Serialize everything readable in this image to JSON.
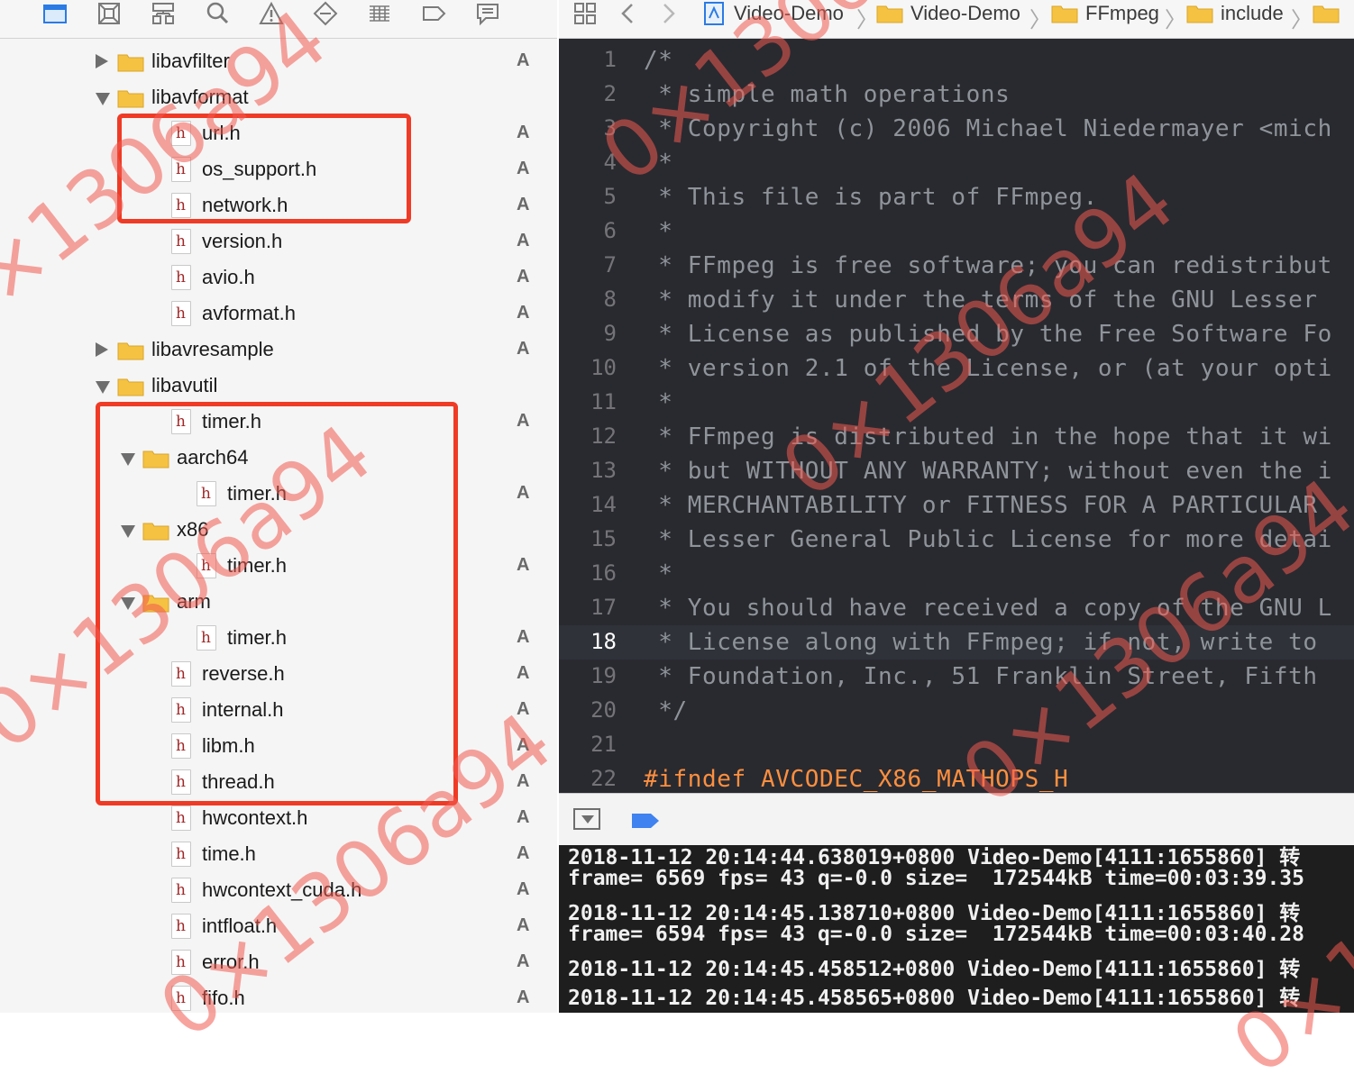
{
  "navigator": {
    "toolbar_icons": [
      "folder-icon",
      "source-control-icon",
      "hierarchy-icon",
      "search-icon",
      "warning-icon",
      "test-icon",
      "debug-icon",
      "breakpoint-icon",
      "report-icon"
    ],
    "tree": [
      {
        "name": "libavfilter",
        "kind": "folder",
        "state": "closed",
        "depth": 0,
        "status": "A"
      },
      {
        "name": "libavformat",
        "kind": "folder",
        "state": "open",
        "depth": 0,
        "status": ""
      },
      {
        "name": "url.h",
        "kind": "h",
        "depth": 1,
        "status": "A"
      },
      {
        "name": "os_support.h",
        "kind": "h",
        "depth": 1,
        "status": "A"
      },
      {
        "name": "network.h",
        "kind": "h",
        "depth": 1,
        "status": "A"
      },
      {
        "name": "version.h",
        "kind": "h",
        "depth": 1,
        "status": "A"
      },
      {
        "name": "avio.h",
        "kind": "h",
        "depth": 1,
        "status": "A"
      },
      {
        "name": "avformat.h",
        "kind": "h",
        "depth": 1,
        "status": "A"
      },
      {
        "name": "libavresample",
        "kind": "folder",
        "state": "closed",
        "depth": 0,
        "status": "A"
      },
      {
        "name": "libavutil",
        "kind": "folder",
        "state": "open",
        "depth": 0,
        "status": ""
      },
      {
        "name": "timer.h",
        "kind": "h",
        "depth": 1,
        "status": "A"
      },
      {
        "name": "aarch64",
        "kind": "folder",
        "state": "open",
        "depth": 1,
        "status": ""
      },
      {
        "name": "timer.h",
        "kind": "h",
        "depth": 2,
        "status": "A"
      },
      {
        "name": "x86",
        "kind": "folder",
        "state": "open",
        "depth": 1,
        "status": ""
      },
      {
        "name": "timer.h",
        "kind": "h",
        "depth": 2,
        "status": "A"
      },
      {
        "name": "arm",
        "kind": "folder",
        "state": "open",
        "depth": 1,
        "status": ""
      },
      {
        "name": "timer.h",
        "kind": "h",
        "depth": 2,
        "status": "A"
      },
      {
        "name": "reverse.h",
        "kind": "h",
        "depth": 1,
        "status": "A"
      },
      {
        "name": "internal.h",
        "kind": "h",
        "depth": 1,
        "status": "A"
      },
      {
        "name": "libm.h",
        "kind": "h",
        "depth": 1,
        "status": "A"
      },
      {
        "name": "thread.h",
        "kind": "h",
        "depth": 1,
        "status": "A"
      },
      {
        "name": "hwcontext.h",
        "kind": "h",
        "depth": 1,
        "status": "A"
      },
      {
        "name": "time.h",
        "kind": "h",
        "depth": 1,
        "status": "A"
      },
      {
        "name": "hwcontext_cuda.h",
        "kind": "h",
        "depth": 1,
        "status": "A"
      },
      {
        "name": "intfloat.h",
        "kind": "h",
        "depth": 1,
        "status": "A"
      },
      {
        "name": "error.h",
        "kind": "h",
        "depth": 1,
        "status": "A"
      },
      {
        "name": "fifo.h",
        "kind": "h",
        "depth": 1,
        "status": "A"
      }
    ],
    "file_icon_letter": "h"
  },
  "jumpbar": {
    "crumbs": [
      "Video-Demo",
      "Video-Demo",
      "FFmpeg",
      "include"
    ]
  },
  "editor": {
    "current_line": 18,
    "lines": [
      {
        "n": "1",
        "text": "/*"
      },
      {
        "n": "2",
        "text": " * simple math operations"
      },
      {
        "n": "3",
        "text": " * Copyright (c) 2006 Michael Niedermayer <mich"
      },
      {
        "n": "4",
        "text": " *"
      },
      {
        "n": "5",
        "text": " * This file is part of FFmpeg."
      },
      {
        "n": "6",
        "text": " *"
      },
      {
        "n": "7",
        "text": " * FFmpeg is free software; you can redistribut"
      },
      {
        "n": "8",
        "text": " * modify it under the terms of the GNU Lesser"
      },
      {
        "n": "9",
        "text": " * License as published by the Free Software Fo"
      },
      {
        "n": "10",
        "text": " * version 2.1 of the License, or (at your opti"
      },
      {
        "n": "11",
        "text": " *"
      },
      {
        "n": "12",
        "text": " * FFmpeg is distributed in the hope that it wi"
      },
      {
        "n": "13",
        "text": " * but WITHOUT ANY WARRANTY; without even the i"
      },
      {
        "n": "14",
        "text": " * MERCHANTABILITY or FITNESS FOR A PARTICULAR"
      },
      {
        "n": "15",
        "text": " * Lesser General Public License for more detai"
      },
      {
        "n": "16",
        "text": " *"
      },
      {
        "n": "17",
        "text": " * You should have received a copy of the GNU L"
      },
      {
        "n": "18",
        "text": " * License along with FFmpeg; if not, write to"
      },
      {
        "n": "19",
        "text": " * Foundation, Inc., 51 Franklin Street, Fifth"
      },
      {
        "n": "20",
        "text": " */"
      },
      {
        "n": "21",
        "text": ""
      },
      {
        "n": "22",
        "text": "#ifndef AVCODEC_X86_MATHOPS_H",
        "pp": true
      }
    ]
  },
  "console": {
    "lines": [
      "2018-11-12 20:14:44.638019+0800 Video-Demo[4111:1655860] 转",
      "frame= 6569 fps= 43 q=-0.0 size=  172544kB time=00:03:39.35",
      "2018-11-12 20:14:45.138710+0800 Video-Demo[4111:1655860] 转",
      "frame= 6594 fps= 43 q=-0.0 size=  172544kB time=00:03:40.28",
      "2018-11-12 20:14:45.458512+0800 Video-Demo[4111:1655860] 转",
      "2018-11-12 20:14:45.458565+0800 Video-Demo[4111:1655860] 转"
    ]
  },
  "watermark": "0×1306a94",
  "colors": {
    "highlight_box": "#ef3b25",
    "folder": "#f5c242",
    "editor_bg": "#292a30",
    "comment": "#8f949a",
    "preprocessor": "#fd8f3f"
  }
}
